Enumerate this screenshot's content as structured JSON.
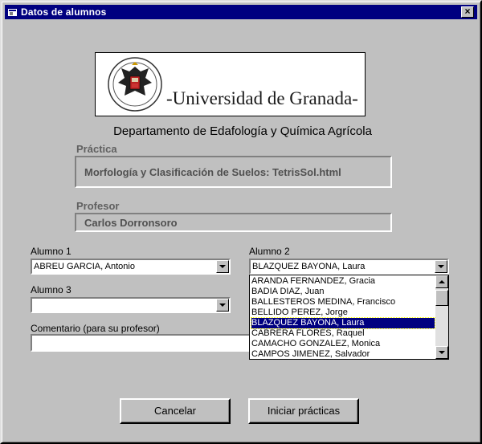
{
  "window": {
    "title": "Datos de alumnos"
  },
  "logo": {
    "text": "-Universidad de Granada-"
  },
  "department": "Departamento de Edafología y Química Agrícola",
  "practica": {
    "label": "Práctica",
    "value": "Morfología y Clasificación de Suelos: TetrisSol.html"
  },
  "profesor": {
    "label": "Profesor",
    "value": "Carlos Dorronsoro"
  },
  "alumno1": {
    "label": "Alumno 1",
    "value": "ABREU GARCIA, Antonio"
  },
  "alumno2": {
    "label": "Alumno 2",
    "value": "BLAZQUEZ BAYONA, Laura",
    "options": [
      "ARANDA FERNANDEZ, Gracia",
      "BADIA DIAZ, Juan",
      "BALLESTEROS MEDINA, Francisco",
      "BELLIDO PEREZ, Jorge",
      "BLAZQUEZ BAYONA, Laura",
      "CABRERA FLORES, Raquel",
      "CAMACHO GONZALEZ, Monica",
      "CAMPOS JIMENEZ, Salvador"
    ],
    "selected_index": 4
  },
  "alumno3": {
    "label": "Alumno 3",
    "value": ""
  },
  "comentario": {
    "label": "Comentario (para su profesor)",
    "value": ""
  },
  "buttons": {
    "cancel": "Cancelar",
    "start": "Iniciar prácticas"
  },
  "colors": {
    "titlebar": "#000080",
    "window": "#c0c0c0",
    "desktop": "#008080",
    "selection": "#000080"
  }
}
